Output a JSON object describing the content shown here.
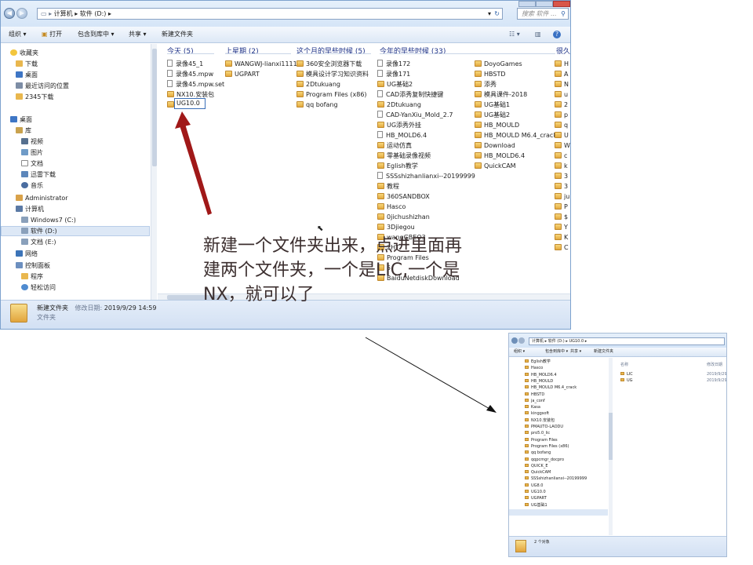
{
  "main_window": {
    "address": {
      "breadcrumb": [
        "计算机",
        "软件 (D:)"
      ],
      "search_placeholder": "搜索 软件 ..."
    },
    "toolbar": [
      "组织 ▾",
      "打开",
      "包含到库中 ▾",
      "共享 ▾",
      "新建文件夹"
    ],
    "tree": {
      "items": [
        {
          "label": "收藏夹",
          "icon": "star-icon"
        },
        {
          "label": "下载",
          "icon": "folder-icon"
        },
        {
          "label": "桌面",
          "icon": "desktop-icon"
        },
        {
          "label": "最近访问的位置",
          "icon": "recent-icon"
        },
        {
          "label": "2345下载",
          "icon": "folder-icon"
        },
        {
          "label": "桌面",
          "icon": "desktop-icon"
        },
        {
          "label": "库",
          "icon": "library-icon"
        },
        {
          "label": "视频",
          "icon": "video-icon"
        },
        {
          "label": "图片",
          "icon": "picture-icon"
        },
        {
          "label": "文档",
          "icon": "document-icon"
        },
        {
          "label": "迅雷下载",
          "icon": "folder-icon"
        },
        {
          "label": "音乐",
          "icon": "music-icon"
        },
        {
          "label": "Administrator",
          "icon": "user-icon"
        },
        {
          "label": "计算机",
          "icon": "computer-icon"
        },
        {
          "label": "Windows7 (C:)",
          "icon": "drive-icon"
        },
        {
          "label": "软件 (D:)",
          "icon": "drive-icon"
        },
        {
          "label": "文档 (E:)",
          "icon": "drive-icon"
        },
        {
          "label": "网络",
          "icon": "network-icon"
        },
        {
          "label": "控制面板",
          "icon": "control-panel-icon"
        },
        {
          "label": "程序",
          "icon": "folder-icon"
        },
        {
          "label": "轻松访问",
          "icon": "ease-icon"
        }
      ]
    },
    "groups": [
      {
        "header": "今天 (5)",
        "items": [
          {
            "label": "录像45_1",
            "icon": "document-icon"
          },
          {
            "label": "录像45.mpw",
            "icon": "document-icon"
          },
          {
            "label": "录像45.mpw.set",
            "icon": "document-icon"
          },
          {
            "label": "NX10.安装包",
            "icon": "folder-icon"
          }
        ]
      },
      {
        "header": "上星期 (2)",
        "items": [
          {
            "label": "WANGWJ-lianxi1111",
            "icon": "folder-icon"
          },
          {
            "label": "UGPART",
            "icon": "folder-icon"
          }
        ]
      },
      {
        "header": "这个月的早些时候 (5)",
        "items": [
          {
            "label": "360安全浏览器下载",
            "icon": "folder-icon"
          },
          {
            "label": "模具设计学习知识资料",
            "icon": "folder-icon"
          },
          {
            "label": "2Dtukuang",
            "icon": "folder-icon"
          },
          {
            "label": "Program Files (x86)",
            "icon": "folder-icon"
          },
          {
            "label": "qq bofang",
            "icon": "folder-icon"
          }
        ]
      },
      {
        "header": "今年的早些时候 (33)",
        "items": [
          {
            "label": "录像172",
            "icon": "document-icon"
          },
          {
            "label": "录像171",
            "icon": "document-icon"
          },
          {
            "label": "UG基础2",
            "icon": "folder-icon"
          },
          {
            "label": "CAD添秀复制快捷键",
            "icon": "document-icon"
          },
          {
            "label": "2Dtukuang",
            "icon": "folder-icon"
          },
          {
            "label": "CAD-YanXiu_Mold_2.7",
            "icon": "document-icon"
          },
          {
            "label": "UG添秀外挂",
            "icon": "folder-icon"
          },
          {
            "label": "HB_MOLD6.4",
            "icon": "document-icon"
          },
          {
            "label": "运动仿真",
            "icon": "folder-icon"
          },
          {
            "label": "零基础录像视频",
            "icon": "folder-icon"
          },
          {
            "label": "Eglish教学",
            "icon": "folder-icon"
          },
          {
            "label": "SSSshizhanlianxi--20199999",
            "icon": "document-icon"
          },
          {
            "label": "教程",
            "icon": "folder-icon"
          },
          {
            "label": "360SANDBOX",
            "icon": "folder-icon"
          },
          {
            "label": "Hasco",
            "icon": "folder-icon"
          },
          {
            "label": "0jichushizhan",
            "icon": "folder-icon"
          },
          {
            "label": "3Djiegou",
            "icon": "folder-icon"
          },
          {
            "label": "wangGBEO3",
            "icon": "folder-icon"
          },
          {
            "label": "2HT",
            "icon": "folder-icon"
          },
          {
            "label": "Program Files",
            "icon": "folder-icon"
          },
          {
            "label": "5",
            "icon": "folder-icon"
          },
          {
            "label": "BaiduNetdiskDownload",
            "icon": "folder-icon"
          }
        ]
      },
      {
        "header": "",
        "items": [
          {
            "label": "DoyoGames",
            "icon": "folder-icon"
          },
          {
            "label": "HBSTD",
            "icon": "folder-icon"
          },
          {
            "label": "添秀",
            "icon": "folder-icon"
          },
          {
            "label": "模具课件-2018",
            "icon": "folder-icon"
          },
          {
            "label": "UG基础1",
            "icon": "folder-icon"
          },
          {
            "label": "UG基础2",
            "icon": "folder-icon"
          },
          {
            "label": "HB_MOULD",
            "icon": "folder-icon"
          },
          {
            "label": "HB_MOULD M6.4_crack",
            "icon": "folder-icon"
          },
          {
            "label": "Download",
            "icon": "folder-icon"
          },
          {
            "label": "HB_MOLD6.4",
            "icon": "folder-icon"
          },
          {
            "label": "QuickCAM",
            "icon": "folder-icon"
          }
        ]
      },
      {
        "header": "很久",
        "items": [
          {
            "label": "H",
            "icon": "folder-icon"
          },
          {
            "label": "A",
            "icon": "folder-icon"
          },
          {
            "label": "N",
            "icon": "folder-icon"
          },
          {
            "label": "u",
            "icon": "folder-icon"
          },
          {
            "label": "2",
            "icon": "folder-icon"
          },
          {
            "label": "p",
            "icon": "folder-icon"
          },
          {
            "label": "q",
            "icon": "folder-icon"
          },
          {
            "label": "U",
            "icon": "folder-icon"
          },
          {
            "label": "W",
            "icon": "folder-icon"
          },
          {
            "label": "c",
            "icon": "folder-icon"
          },
          {
            "label": "k",
            "icon": "folder-icon"
          },
          {
            "label": "3",
            "icon": "folder-icon"
          },
          {
            "label": "3",
            "icon": "folder-icon"
          },
          {
            "label": "ju",
            "icon": "folder-icon"
          },
          {
            "label": "P",
            "icon": "folder-icon"
          },
          {
            "label": "$",
            "icon": "folder-icon"
          },
          {
            "label": "Y",
            "icon": "folder-icon"
          },
          {
            "label": "K",
            "icon": "folder-icon"
          },
          {
            "label": "C",
            "icon": "folder-icon"
          }
        ]
      }
    ],
    "rename_value": "UG10.0",
    "status": {
      "name": "新建文件夹",
      "modified_label": "修改日期:",
      "modified_value": "2019/9/29 14:59",
      "type": "文件夹"
    }
  },
  "annotation": {
    "lines": [
      "新建一个文件夹出来，点进里面再",
      "建两个文件夹，一个是LIC,一个是",
      "NX，就可以了"
    ],
    "arrow_color": "#a01818"
  },
  "inset_window": {
    "breadcrumb": [
      "计算机",
      "软件 (D:)",
      "UG10.0"
    ],
    "toolbar": [
      "组织 ▾",
      "包含到库中 ▾",
      "共享 ▾",
      "新建文件夹"
    ],
    "header_name": "名称",
    "header_date": "修改日期",
    "tree": [
      "Eglish教学",
      "Hasco",
      "HB_MOLD6.4",
      "HB_MOULD",
      "HB_MOULD M6.4_crack",
      "HBSTD",
      "ja_conf",
      "Kasa",
      "kinggsoft",
      "NX10.安装包",
      "PMAUTO-LAODU",
      "pro5.0_lic",
      "Program Files",
      "Program Files (x86)",
      "qq bofang",
      "qqpcmgr_docpro",
      "QUICK_E",
      "QuickCAM",
      "SSSshizhanlianxi--20199999",
      "UG8.0",
      "UG10.0",
      "UGPART",
      "UG基础1"
    ],
    "files": [
      {
        "name": "LIC",
        "date": "2019/9/29"
      },
      {
        "name": "UG",
        "date": "2019/9/29"
      }
    ],
    "status": "2 个对象"
  }
}
